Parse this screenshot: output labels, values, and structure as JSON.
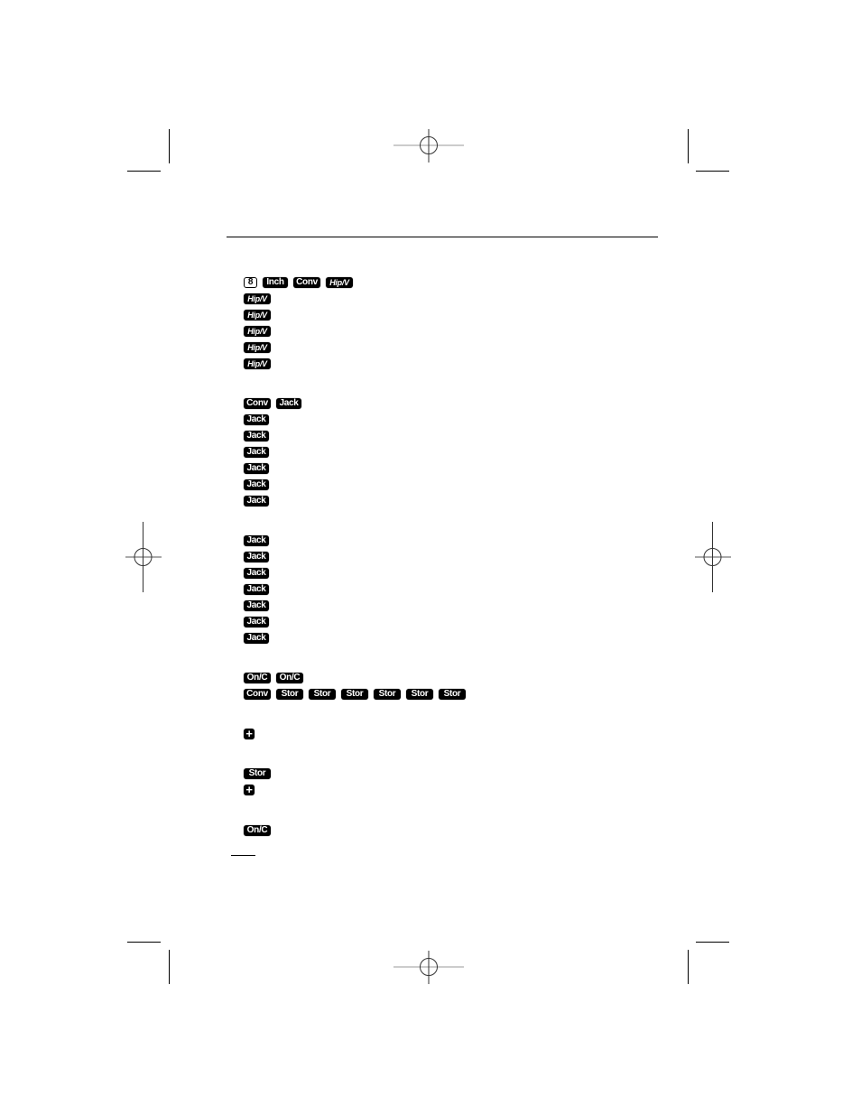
{
  "document": {
    "type": "calculator manual page (print proof)",
    "key_sequences": [
      {
        "keys": [
          {
            "label": "8",
            "style": "digit"
          },
          {
            "label": "Inch",
            "style": "inch"
          },
          {
            "label": "Conv",
            "style": "conv"
          },
          {
            "label": "Hip/V",
            "style": "hip"
          }
        ]
      },
      {
        "keys": [
          {
            "label": "Hip/V",
            "style": "hip"
          }
        ]
      },
      {
        "keys": [
          {
            "label": "Hip/V",
            "style": "hip"
          }
        ]
      },
      {
        "keys": [
          {
            "label": "Hip/V",
            "style": "hip"
          }
        ]
      },
      {
        "keys": [
          {
            "label": "Hip/V",
            "style": "hip"
          }
        ]
      },
      {
        "keys": [
          {
            "label": "Hip/V",
            "style": "hip"
          }
        ]
      },
      {
        "keys": [
          {
            "label": "Conv",
            "style": "conv"
          },
          {
            "label": "Jack",
            "style": "jack"
          }
        ]
      },
      {
        "keys": [
          {
            "label": "Jack",
            "style": "jack"
          }
        ]
      },
      {
        "keys": [
          {
            "label": "Jack",
            "style": "jack"
          }
        ]
      },
      {
        "keys": [
          {
            "label": "Jack",
            "style": "jack"
          }
        ]
      },
      {
        "keys": [
          {
            "label": "Jack",
            "style": "jack"
          }
        ]
      },
      {
        "keys": [
          {
            "label": "Jack",
            "style": "jack"
          }
        ]
      },
      {
        "keys": [
          {
            "label": "Jack",
            "style": "jack"
          }
        ]
      },
      {
        "keys": [
          {
            "label": "Jack",
            "style": "jack"
          }
        ]
      },
      {
        "keys": [
          {
            "label": "Jack",
            "style": "jack"
          }
        ]
      },
      {
        "keys": [
          {
            "label": "Jack",
            "style": "jack"
          }
        ]
      },
      {
        "keys": [
          {
            "label": "Jack",
            "style": "jack"
          }
        ]
      },
      {
        "keys": [
          {
            "label": "Jack",
            "style": "jack"
          }
        ]
      },
      {
        "keys": [
          {
            "label": "Jack",
            "style": "jack"
          }
        ]
      },
      {
        "keys": [
          {
            "label": "Jack",
            "style": "jack"
          }
        ]
      },
      {
        "keys": [
          {
            "label": "On/C",
            "style": "onc"
          },
          {
            "label": "On/C",
            "style": "onc"
          }
        ]
      },
      {
        "keys": [
          {
            "label": "Conv",
            "style": "conv"
          },
          {
            "label": "Stor",
            "style": "stor"
          },
          {
            "label": "Stor",
            "style": "stor"
          },
          {
            "label": "Stor",
            "style": "stor"
          },
          {
            "label": "Stor",
            "style": "stor"
          },
          {
            "label": "Stor",
            "style": "stor"
          },
          {
            "label": "Stor",
            "style": "stor"
          }
        ]
      },
      {
        "keys": [
          {
            "label": "+",
            "style": "plus"
          }
        ]
      },
      {
        "keys": [
          {
            "label": "Stor",
            "style": "stor"
          }
        ]
      },
      {
        "keys": [
          {
            "label": "+",
            "style": "plus"
          }
        ]
      },
      {
        "keys": [
          {
            "label": "On/C",
            "style": "onc"
          }
        ]
      }
    ]
  },
  "icons": {
    "registration_mark": "crosshair-circle-icon",
    "plus_key": "plus-key-icon"
  },
  "colors": {
    "key_background": "#000000",
    "key_text": "#ffffff",
    "registration_horizontal": "#cccccc"
  }
}
